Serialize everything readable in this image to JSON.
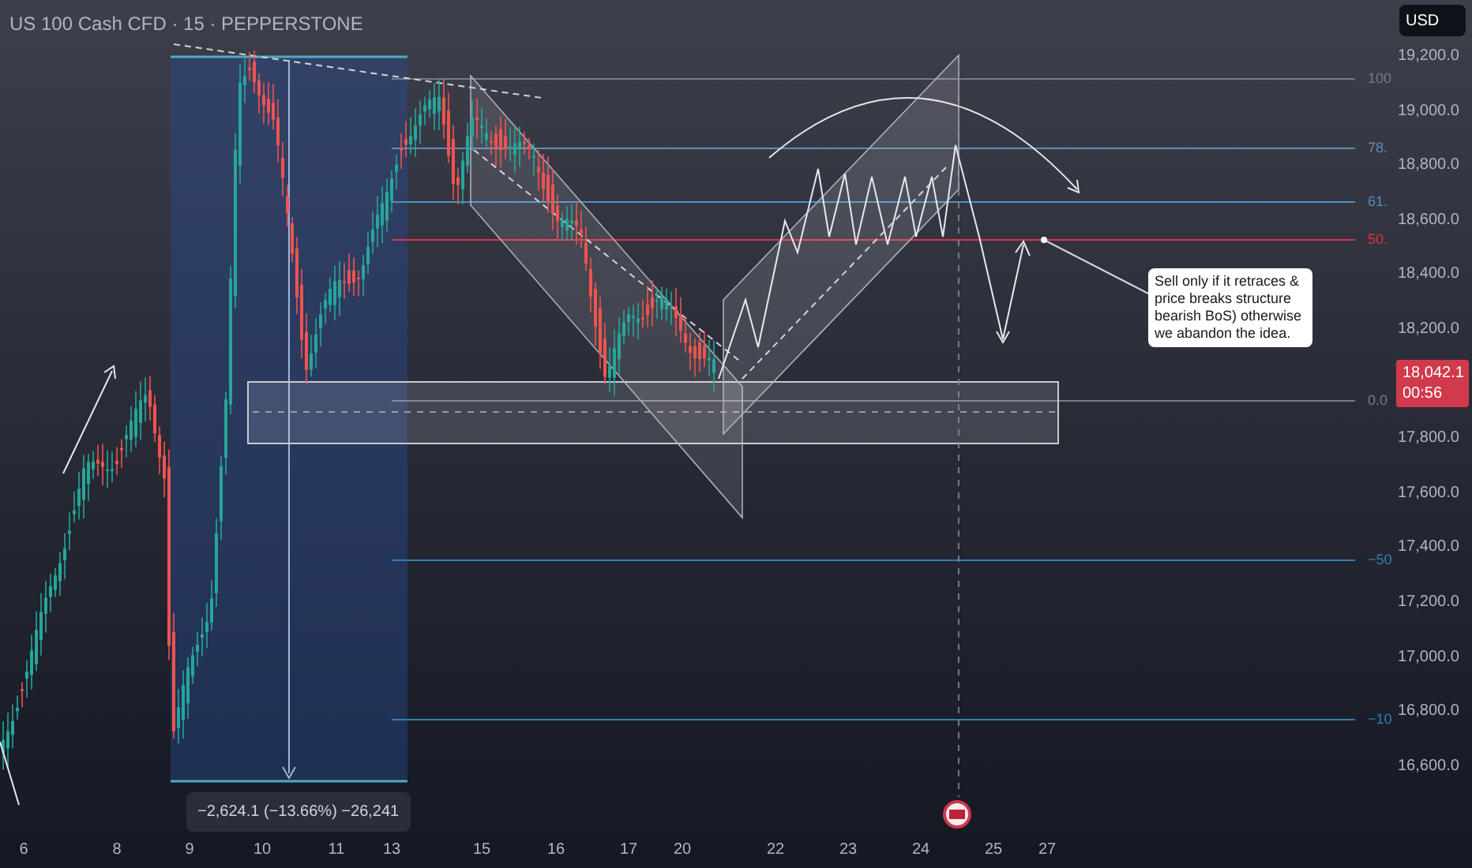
{
  "header": {
    "title": "US 100 Cash CFD · 15 · PEPPERSTONE"
  },
  "currency_button": "USD",
  "fib_levels": [
    {
      "label": "100",
      "color": "#787b86"
    },
    {
      "label": "78.",
      "color": "#5b8fb0"
    },
    {
      "label": "61.",
      "color": "#4f8fc0"
    },
    {
      "label": "50.",
      "color": "#e0314b"
    },
    {
      "label": "0.0",
      "color": "#787b86"
    },
    {
      "label": "−50",
      "color": "#2f7fb5"
    },
    {
      "label": "−10",
      "color": "#2f7fb5"
    }
  ],
  "callout": {
    "text": "Sell only if it retraces & price breaks structure bearish BoS) otherwise we abandon the idea."
  },
  "measurement": {
    "text": "−2,624.1 (−13.66%) −26,241"
  },
  "price_axis": {
    "labels": [
      "19,200.0",
      "19,000.0",
      "18,800.0",
      "18,600.0",
      "18,400.0",
      "18,200.0",
      "17,800.0",
      "17,600.0",
      "17,400.0",
      "17,200.0",
      "17,000.0",
      "16,800.0",
      "16,600.0"
    ]
  },
  "price_tag": {
    "price": "18,042.1",
    "countdown": "00:56"
  },
  "time_axis": {
    "labels": [
      "6",
      "8",
      "9",
      "10",
      "11",
      "13",
      "15",
      "16",
      "17",
      "20",
      "22",
      "23",
      "24",
      "25",
      "27"
    ]
  }
}
